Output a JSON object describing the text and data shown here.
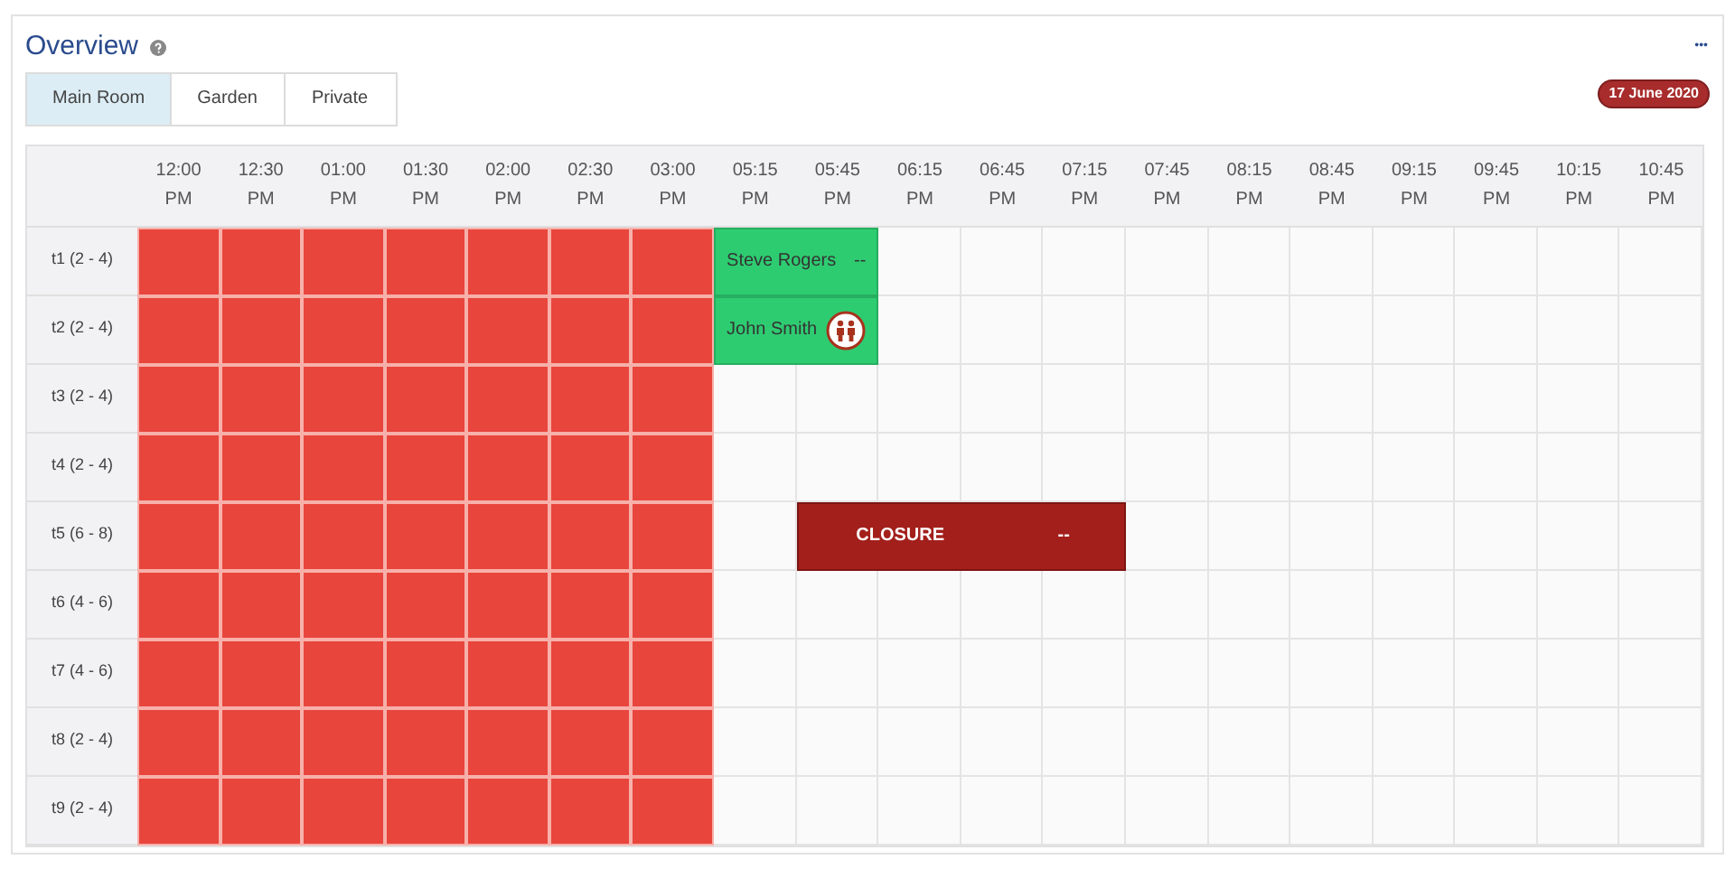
{
  "title": "Overview",
  "menu": "•••",
  "date": "17 June 2020",
  "tabs": [
    {
      "label": "Main Room",
      "selected": true
    },
    {
      "label": "Garden",
      "selected": false
    },
    {
      "label": "Private",
      "selected": false
    }
  ],
  "columns": [
    {
      "time": "12:00",
      "period": "PM"
    },
    {
      "time": "12:30",
      "period": "PM"
    },
    {
      "time": "01:00",
      "period": "PM"
    },
    {
      "time": "01:30",
      "period": "PM"
    },
    {
      "time": "02:00",
      "period": "PM"
    },
    {
      "time": "02:30",
      "period": "PM"
    },
    {
      "time": "03:00",
      "period": "PM"
    },
    {
      "time": "05:15",
      "period": "PM"
    },
    {
      "time": "05:45",
      "period": "PM"
    },
    {
      "time": "06:15",
      "period": "PM"
    },
    {
      "time": "06:45",
      "period": "PM"
    },
    {
      "time": "07:15",
      "period": "PM"
    },
    {
      "time": "07:45",
      "period": "PM"
    },
    {
      "time": "08:15",
      "period": "PM"
    },
    {
      "time": "08:45",
      "period": "PM"
    },
    {
      "time": "09:15",
      "period": "PM"
    },
    {
      "time": "09:45",
      "period": "PM"
    },
    {
      "time": "10:15",
      "period": "PM"
    },
    {
      "time": "10:45",
      "period": "PM"
    }
  ],
  "rows": [
    {
      "label": "t1 (2 - 4)",
      "slots": [
        {
          "kind": "blocked"
        },
        {
          "kind": "blocked"
        },
        {
          "kind": "blocked"
        },
        {
          "kind": "blocked"
        },
        {
          "kind": "blocked"
        },
        {
          "kind": "blocked"
        },
        {
          "kind": "blocked"
        },
        {
          "kind": "booking"
        },
        {
          "kind": "booking"
        },
        {
          "kind": "open"
        },
        {
          "kind": "open"
        },
        {
          "kind": "open"
        },
        {
          "kind": "open"
        },
        {
          "kind": "open"
        },
        {
          "kind": "open"
        },
        {
          "kind": "open"
        },
        {
          "kind": "open"
        },
        {
          "kind": "open"
        },
        {
          "kind": "open"
        }
      ],
      "booking": {
        "kind": "guest",
        "name": "Steve Rogers",
        "note": "--"
      }
    },
    {
      "label": "t2 (2 - 4)",
      "slots": [
        {
          "kind": "blocked"
        },
        {
          "kind": "blocked"
        },
        {
          "kind": "blocked"
        },
        {
          "kind": "blocked"
        },
        {
          "kind": "blocked"
        },
        {
          "kind": "blocked"
        },
        {
          "kind": "blocked"
        },
        {
          "kind": "booking"
        },
        {
          "kind": "booking"
        },
        {
          "kind": "open"
        },
        {
          "kind": "open"
        },
        {
          "kind": "open"
        },
        {
          "kind": "open"
        },
        {
          "kind": "open"
        },
        {
          "kind": "open"
        },
        {
          "kind": "open"
        },
        {
          "kind": "open"
        },
        {
          "kind": "open"
        },
        {
          "kind": "open"
        }
      ],
      "booking": {
        "kind": "party",
        "name": "John Smith"
      }
    },
    {
      "label": "t3 (2 - 4)",
      "slots": [
        {
          "kind": "blocked"
        },
        {
          "kind": "blocked"
        },
        {
          "kind": "blocked"
        },
        {
          "kind": "blocked"
        },
        {
          "kind": "blocked"
        },
        {
          "kind": "blocked"
        },
        {
          "kind": "blocked"
        },
        {
          "kind": "open"
        },
        {
          "kind": "open"
        },
        {
          "kind": "open"
        },
        {
          "kind": "open"
        },
        {
          "kind": "open"
        },
        {
          "kind": "open"
        },
        {
          "kind": "open"
        },
        {
          "kind": "open"
        },
        {
          "kind": "open"
        },
        {
          "kind": "open"
        },
        {
          "kind": "open"
        },
        {
          "kind": "open"
        }
      ]
    },
    {
      "label": "t4 (2 - 4)",
      "slots": [
        {
          "kind": "blocked"
        },
        {
          "kind": "blocked"
        },
        {
          "kind": "blocked"
        },
        {
          "kind": "blocked"
        },
        {
          "kind": "blocked"
        },
        {
          "kind": "blocked"
        },
        {
          "kind": "blocked"
        },
        {
          "kind": "open"
        },
        {
          "kind": "open"
        },
        {
          "kind": "open"
        },
        {
          "kind": "open"
        },
        {
          "kind": "open"
        },
        {
          "kind": "open"
        },
        {
          "kind": "open"
        },
        {
          "kind": "open"
        },
        {
          "kind": "open"
        },
        {
          "kind": "open"
        },
        {
          "kind": "open"
        },
        {
          "kind": "open"
        }
      ]
    },
    {
      "label": "t5 (6 - 8)",
      "slots": [
        {
          "kind": "blocked"
        },
        {
          "kind": "blocked"
        },
        {
          "kind": "blocked"
        },
        {
          "kind": "blocked"
        },
        {
          "kind": "blocked"
        },
        {
          "kind": "blocked"
        },
        {
          "kind": "blocked"
        },
        {
          "kind": "open"
        },
        {
          "kind": "booking"
        },
        {
          "kind": "booking"
        },
        {
          "kind": "booking"
        },
        {
          "kind": "booking"
        },
        {
          "kind": "open"
        },
        {
          "kind": "open"
        },
        {
          "kind": "open"
        },
        {
          "kind": "open"
        },
        {
          "kind": "open"
        },
        {
          "kind": "open"
        },
        {
          "kind": "open"
        }
      ],
      "booking": {
        "kind": "closure",
        "name": "CLOSURE",
        "note": "--"
      }
    },
    {
      "label": "t6 (4 - 6)",
      "slots": [
        {
          "kind": "blocked"
        },
        {
          "kind": "blocked"
        },
        {
          "kind": "blocked"
        },
        {
          "kind": "blocked"
        },
        {
          "kind": "blocked"
        },
        {
          "kind": "blocked"
        },
        {
          "kind": "blocked"
        },
        {
          "kind": "open"
        },
        {
          "kind": "open"
        },
        {
          "kind": "open"
        },
        {
          "kind": "open"
        },
        {
          "kind": "open"
        },
        {
          "kind": "open"
        },
        {
          "kind": "open"
        },
        {
          "kind": "open"
        },
        {
          "kind": "open"
        },
        {
          "kind": "open"
        },
        {
          "kind": "open"
        },
        {
          "kind": "open"
        }
      ]
    },
    {
      "label": "t7 (4 - 6)",
      "slots": [
        {
          "kind": "blocked"
        },
        {
          "kind": "blocked"
        },
        {
          "kind": "blocked"
        },
        {
          "kind": "blocked"
        },
        {
          "kind": "blocked"
        },
        {
          "kind": "blocked"
        },
        {
          "kind": "blocked"
        },
        {
          "kind": "open"
        },
        {
          "kind": "open"
        },
        {
          "kind": "open"
        },
        {
          "kind": "open"
        },
        {
          "kind": "open"
        },
        {
          "kind": "open"
        },
        {
          "kind": "open"
        },
        {
          "kind": "open"
        },
        {
          "kind": "open"
        },
        {
          "kind": "open"
        },
        {
          "kind": "open"
        },
        {
          "kind": "open"
        }
      ]
    },
    {
      "label": "t8 (2 - 4)",
      "slots": [
        {
          "kind": "blocked"
        },
        {
          "kind": "blocked"
        },
        {
          "kind": "blocked"
        },
        {
          "kind": "blocked"
        },
        {
          "kind": "blocked"
        },
        {
          "kind": "blocked"
        },
        {
          "kind": "blocked"
        },
        {
          "kind": "open"
        },
        {
          "kind": "open"
        },
        {
          "kind": "open"
        },
        {
          "kind": "open"
        },
        {
          "kind": "open"
        },
        {
          "kind": "open"
        },
        {
          "kind": "open"
        },
        {
          "kind": "open"
        },
        {
          "kind": "open"
        },
        {
          "kind": "open"
        },
        {
          "kind": "open"
        },
        {
          "kind": "open"
        }
      ]
    },
    {
      "label": "t9 (2 - 4)",
      "slots": [
        {
          "kind": "blocked"
        },
        {
          "kind": "blocked"
        },
        {
          "kind": "blocked"
        },
        {
          "kind": "blocked"
        },
        {
          "kind": "blocked"
        },
        {
          "kind": "blocked"
        },
        {
          "kind": "blocked"
        },
        {
          "kind": "open"
        },
        {
          "kind": "open"
        },
        {
          "kind": "open"
        },
        {
          "kind": "open"
        },
        {
          "kind": "open"
        },
        {
          "kind": "open"
        },
        {
          "kind": "open"
        },
        {
          "kind": "open"
        },
        {
          "kind": "open"
        },
        {
          "kind": "open"
        },
        {
          "kind": "open"
        },
        {
          "kind": "open"
        }
      ]
    }
  ]
}
